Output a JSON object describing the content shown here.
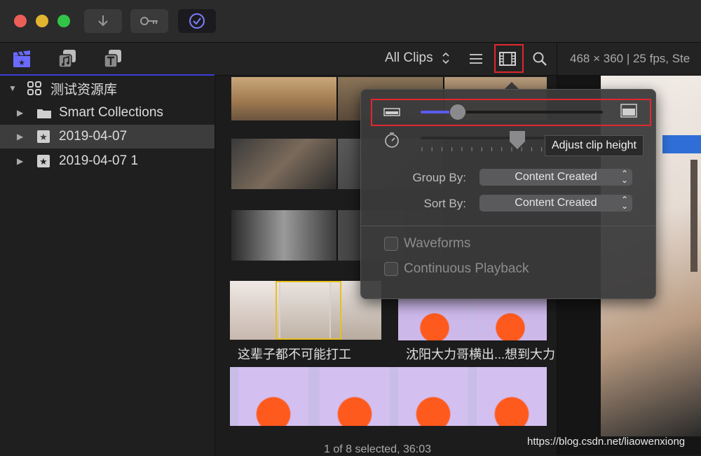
{
  "window": {
    "traffic_lights": {
      "close": "#ec5f57",
      "minimize": "#e1b52f",
      "zoom": "#33c348"
    },
    "buttons": [
      {
        "name": "import-button",
        "icon": "down-arrow-icon"
      },
      {
        "name": "keyword-button",
        "icon": "key-icon"
      },
      {
        "name": "background-tasks-button",
        "icon": "checkmark-circle-icon"
      }
    ]
  },
  "toolbar": {
    "library_icons": [
      "clapper-icon",
      "music-icon",
      "titles-icon"
    ],
    "filter_label": "All Clips",
    "list_view_icon": "list-view-icon",
    "filmstrip_icon": "filmstrip-icon",
    "search_icon": "search-icon",
    "format_info": "468 × 360 | 25 fps, Ste"
  },
  "sidebar": {
    "library_name": "测试资源库",
    "items": [
      {
        "label": "Smart Collections",
        "icon": "folder-icon"
      },
      {
        "label": "2019-04-07",
        "icon": "star-event-icon",
        "selected": true
      },
      {
        "label": "2019-04-07 1",
        "icon": "star-event-icon",
        "selected": false
      }
    ]
  },
  "clips": {
    "label_1": "这辈子都不可能打工",
    "label_2": "沈阳大力哥横出...想到大力"
  },
  "status": {
    "text": "1 of 8 selected, 36:03"
  },
  "watermark": "https://blog.csdn.net/liaowenxiong",
  "popover": {
    "clip_height_level": 0.2,
    "duration_level": 0.53,
    "group_by_label": "Group By:",
    "group_by_value": "Content Created",
    "sort_by_label": "Sort By:",
    "sort_by_value": "Content Created",
    "waveforms_label": "Waveforms",
    "waveforms_checked": false,
    "continuous_label": "Continuous Playback",
    "continuous_checked": false
  },
  "tooltip": "Adjust clip height",
  "accent": "#5b5bf0",
  "highlight": "#e0272e"
}
